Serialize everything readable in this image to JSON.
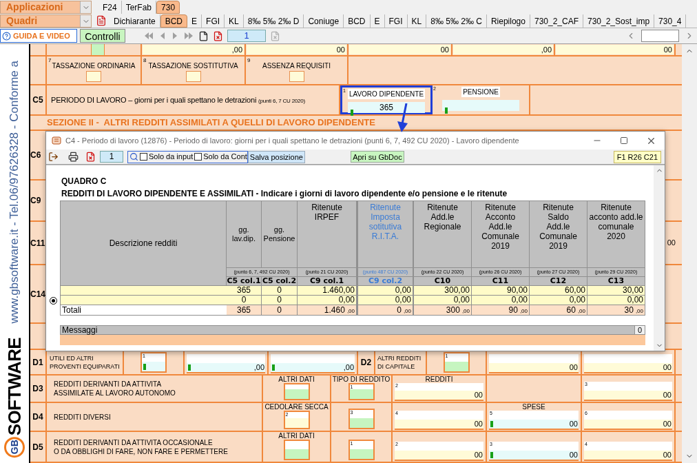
{
  "app_selector": "Applicazioni",
  "app_tabs": [
    {
      "label": "F24",
      "selected": false
    },
    {
      "label": "TerFab",
      "selected": false
    },
    {
      "label": "730",
      "selected": true
    }
  ],
  "quadri_selector": "Quadri",
  "quadri_tabs": [
    {
      "label": "Dichiarante",
      "selected": false
    },
    {
      "label": "BCD",
      "selected": true
    },
    {
      "label": "E",
      "selected": false
    },
    {
      "label": "FGI",
      "selected": false
    },
    {
      "label": "KL",
      "selected": false
    },
    {
      "label": "8‰ 5‰ 2‰ D",
      "selected": false
    },
    {
      "label": "Coniuge",
      "selected": false
    },
    {
      "label": "BCD",
      "selected": false
    },
    {
      "label": "E",
      "selected": false
    },
    {
      "label": "FGI",
      "selected": false
    },
    {
      "label": "KL",
      "selected": false
    },
    {
      "label": "8‰ 5‰ 2‰ C",
      "selected": false
    },
    {
      "label": "Riepilogo",
      "selected": false
    },
    {
      "label": "730_2_CAF",
      "selected": false
    },
    {
      "label": "730_2_Sost_imp",
      "selected": false
    },
    {
      "label": "730_4",
      "selected": false
    }
  ],
  "guide_button": "GUIDA E VIDEO",
  "controls_button": "Controlli",
  "page_field": "1",
  "side_text": "www.gbsoftware.it - Tel.06/97626328 - Conforme a",
  "logo": {
    "mark": "GB",
    "name": "SOFTWARE"
  },
  "c4_amounts": [
    ",00",
    "00",
    "00",
    ",00",
    "00"
  ],
  "options": [
    {
      "number": "7",
      "label": "TASSAZIONE ORDINARIA",
      "checked": false
    },
    {
      "number": "8",
      "label": "TASSAZIONE SOSTITUTIVA",
      "checked": false
    },
    {
      "number": "9",
      "label": "ASSENZA REQUISITI",
      "checked": false
    }
  ],
  "c5": {
    "code": "C5",
    "description": "PERIODO DI LAVORO – giorni per i quali spettano le detrazioni",
    "note": "(punti 6, 7 CU 2020)",
    "fields": [
      {
        "number": "1",
        "label": "LAVORO DIPENDENTE",
        "value": "365",
        "highlighted": true
      },
      {
        "number": "2",
        "label": "PENSIONE",
        "highlighted": false
      }
    ]
  },
  "section_heading": "SEZIONE II -  ALTRI REDDITI ASSIMILATI A QUELLI DI LAVORO DIPENDENTE",
  "row_codes": [
    "C6",
    "C9",
    "C11",
    "C14"
  ],
  "c11_amount": "00",
  "d_rows": [
    {
      "code": "D1",
      "description": "UTILI ED ALTRI\nPROVENTI EQUIPARATI",
      "cells": [
        {
          "kind": "box",
          "number": "1",
          "color": "#e6fafa",
          "marker": true
        },
        {
          "kind": "amount",
          "value": ",00",
          "marker": true
        },
        {
          "kind": "amount",
          "value": ",00",
          "marker": true
        },
        {
          "kind": "code",
          "code": "D2",
          "text": "ALTRI REDDITI\nDI CAPITALE"
        },
        {
          "kind": "box",
          "number": "1",
          "color": "#c6f5c0",
          "marker": false
        },
        {
          "kind": "amount",
          "value": "00",
          "marker": false
        },
        {
          "kind": "amount",
          "value": "00",
          "marker": false
        }
      ]
    },
    {
      "code": "D3",
      "description": "REDDITI DERIVANTI DA ATTIVITA\nASSIMILATE AL LAVORO AUTONOMO",
      "cells": [
        {
          "kind": "box",
          "header": "ALTRI DATI",
          "color": "#c6f5c0",
          "marker": false
        },
        {
          "kind": "box",
          "header": "TIPO DI REDDITO",
          "number": "1",
          "color": "#c6f5c0",
          "marker": false
        },
        {
          "kind": "amount",
          "header": "REDDITI",
          "number": "2",
          "value": "00",
          "marker": false
        },
        {
          "kind": "empty"
        },
        {
          "kind": "amount",
          "number": "3",
          "value": "00",
          "marker": false
        }
      ]
    },
    {
      "code": "D4",
      "description": "REDDITI DIVERSI",
      "cells": [
        {
          "kind": "box",
          "header": "CEDOLARE SECCA",
          "number": "2",
          "color": "#fffbd8",
          "marker": false
        },
        {
          "kind": "box",
          "number": "3",
          "color": "#c6f5c0",
          "marker": false
        },
        {
          "kind": "amount",
          "number": "4",
          "value": "00",
          "marker": false
        },
        {
          "kind": "amount",
          "header": "SPESE",
          "number": "5",
          "value": "00",
          "marker": true
        },
        {
          "kind": "amount",
          "number": "6",
          "value": "00",
          "marker": false
        }
      ]
    },
    {
      "code": "D5",
      "description": "REDDITI DERIVANTI DA ATTIVITA OCCASIONALE\nO DA OBBLIGHI DI FARE, NON FARE E PERMETTERE",
      "cells": [
        {
          "kind": "box",
          "header": "ALTRI DATI",
          "color": "#c6f5c0",
          "marker": false
        },
        {
          "kind": "box",
          "number": "1",
          "color": "#c6f5c0",
          "marker": false
        },
        {
          "kind": "amount",
          "number": "2",
          "value": "00",
          "marker": false
        },
        {
          "kind": "amount",
          "number": "3",
          "value": "00",
          "marker": true
        },
        {
          "kind": "amount",
          "number": "4",
          "value": "00",
          "marker": false
        }
      ]
    }
  ],
  "dialog": {
    "title": "C4 - Periodo di lavoro (12876) - Periodo di lavoro: giorni per i quali spettano le detrazioni (punti 6, 7, 492 CU 2020) - Lavoro dipendente",
    "record_field": "1",
    "filters": [
      {
        "label": "Solo da input",
        "checked": false
      },
      {
        "label": "Solo da Cont",
        "checked": false
      }
    ],
    "save_button": "Salva posizione",
    "open_button": "Apri su GbDoc",
    "position": "F1 R26 C21",
    "quadro": "QUADRO C",
    "heading": "REDDITI DI LAVORO DIPENDENTE E ASSIMILATI - Indicare i giorni di lavoro dipendente e/o pensione e le ritenute",
    "table": {
      "description_header": "Descrizione redditi",
      "columns": [
        {
          "header": "gg.\nlav.dip.",
          "reference": "(punto 6, 7, 492 CU 2020)",
          "code": "C5 col.1",
          "highlighted": false
        },
        {
          "header": "gg.\nPensione",
          "code": "C5 col.2",
          "highlighted": false
        },
        {
          "header": "Ritenute\nIRPEF",
          "reference": "(punto 21 CU 2020)",
          "code": "C9 col.1",
          "highlighted": false
        },
        {
          "header": "Ritenute\nImposta\nsotitutiva\nR.I.T.A.",
          "reference": "(punto 487 CU 2020)",
          "code": "C9 col.2",
          "highlighted": true
        },
        {
          "header": "Ritenute\nAdd.le\nRegionale",
          "reference": "(punto 22 CU 2020)",
          "code": "C10",
          "highlighted": false
        },
        {
          "header": "Ritenute\nAcconto\nAdd.le\nComunale\n2019",
          "reference": "(punto 26 CU 2020)",
          "code": "C11",
          "highlighted": false
        },
        {
          "header": "Ritenute\nSaldo\nAdd.le\nComunale\n2019",
          "reference": "(punto 27 CU 2020)",
          "code": "C12",
          "highlighted": false
        },
        {
          "header": "Ritenute\nacconto add.le\ncomunale\n2020",
          "reference": "(punto 29 CU 2020)",
          "code": "C13",
          "highlighted": false
        }
      ],
      "rows": [
        {
          "current": false,
          "cells": [
            "365",
            "0",
            "1.460,00",
            "0,00",
            "300,00",
            "90,00",
            "60,00",
            "30,00"
          ]
        },
        {
          "current": true,
          "cells": [
            "0",
            "0",
            "0,00",
            "0,00",
            "0,00",
            "0,00",
            "0,00",
            "0,00"
          ]
        }
      ],
      "totals": {
        "label": "Totali",
        "cells": [
          {
            "value": "365"
          },
          {
            "value": "0"
          },
          {
            "value": "1.460",
            "decimals": ",00"
          },
          {
            "value": "0",
            "decimals": ",00"
          },
          {
            "value": "300",
            "decimals": ",00"
          },
          {
            "value": "90",
            "decimals": ",00"
          },
          {
            "value": "60",
            "decimals": ",00"
          },
          {
            "value": "30",
            "decimals": ",00"
          }
        ]
      }
    },
    "messages": {
      "label": "Messaggi",
      "count": "0"
    }
  }
}
